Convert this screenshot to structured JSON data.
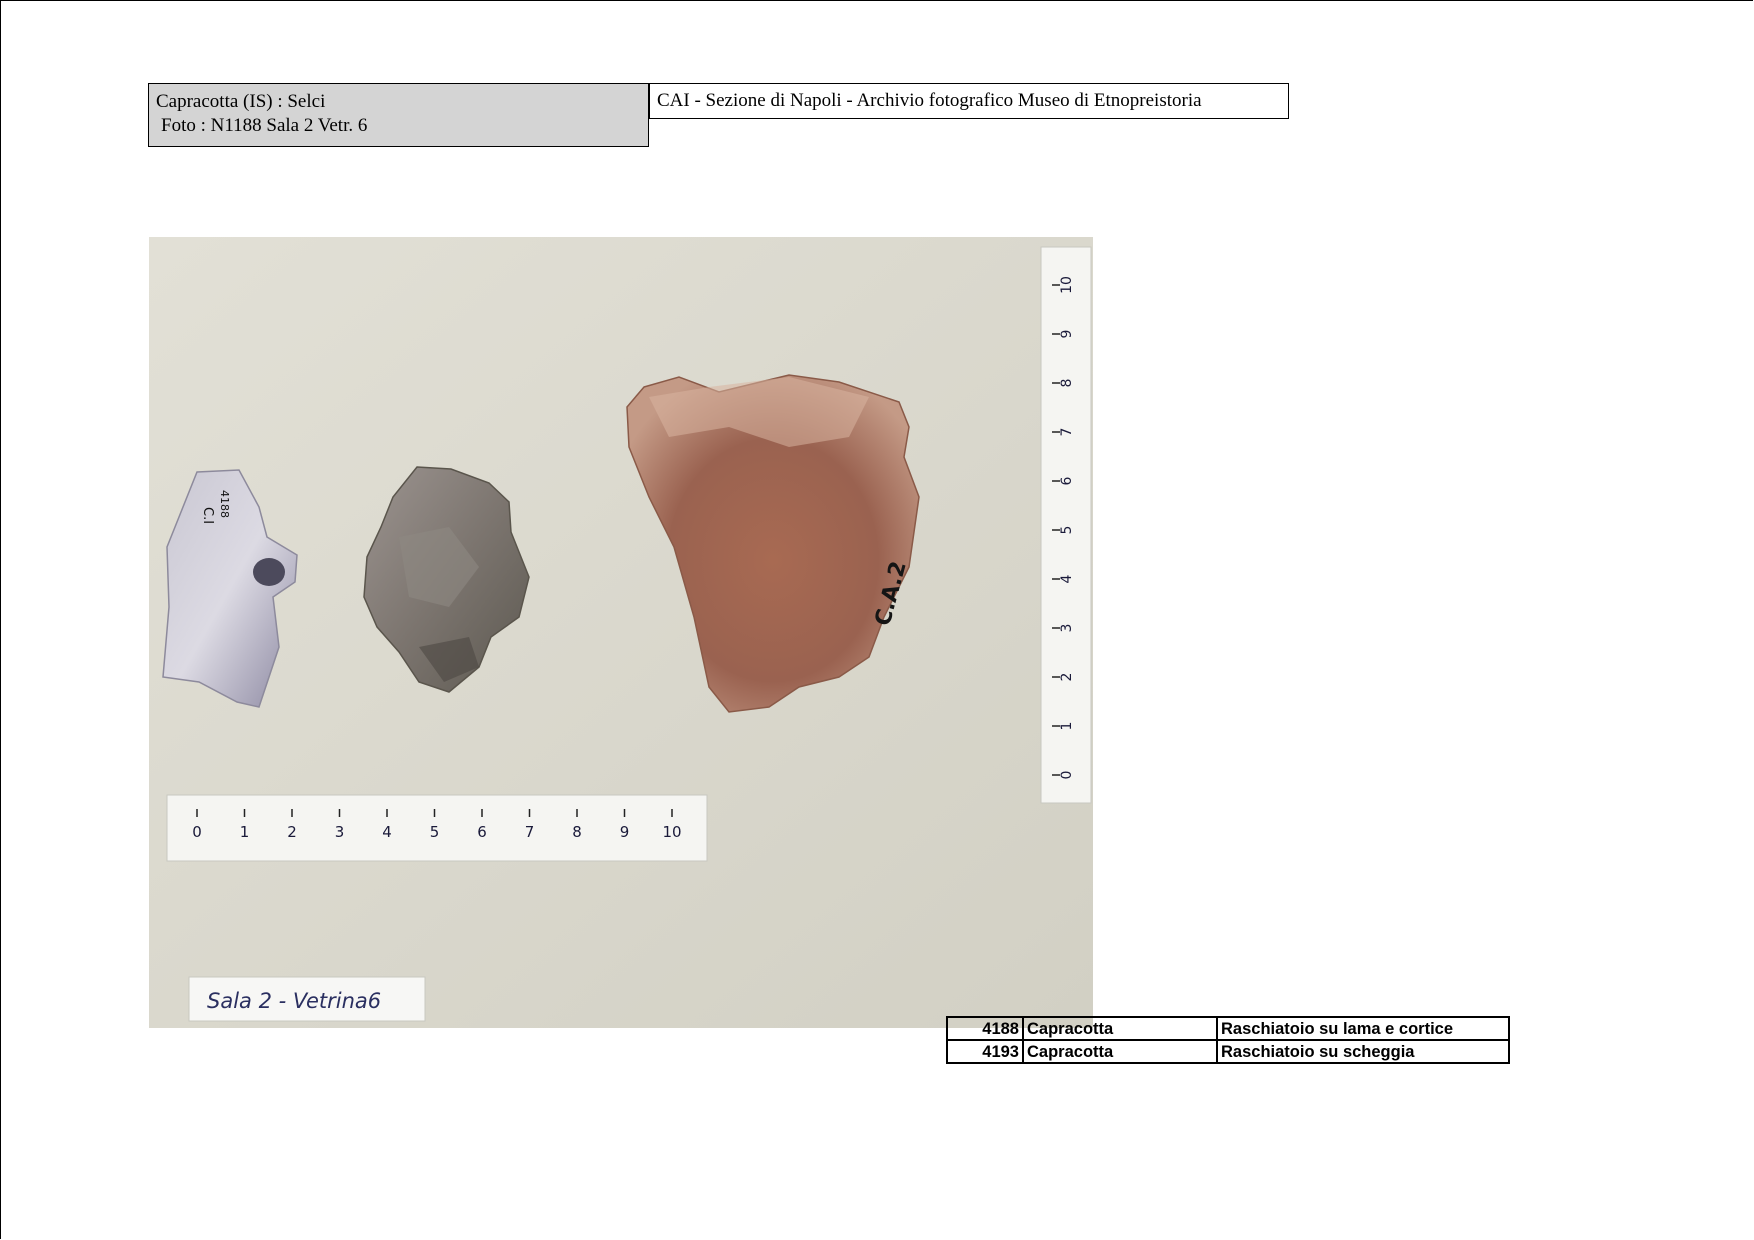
{
  "header": {
    "info_line1": "Capracotta   (IS)  :  Selci",
    "info_line2": "Foto : N1188  Sala 2 Vetr.  6",
    "archive_title": "CAI - Sezione di Napoli  - Archivio fotografico Museo di Etnopreistoria"
  },
  "photo": {
    "artifact_label_1a": "C.I",
    "artifact_label_1b": "4188",
    "artifact_label_2": "C.A.2",
    "case_label": "Sala 2 - Vetrina6",
    "ruler_ticks": [
      "0",
      "1",
      "2",
      "3",
      "4",
      "5",
      "6",
      "7",
      "8",
      "9",
      "10"
    ]
  },
  "catalog": {
    "rows": [
      {
        "number": "4188",
        "locality": "Capracotta",
        "description": "Raschiatoio su lama e cortice"
      },
      {
        "number": "4193",
        "locality": "Capracotta",
        "description": "Raschiatoio su scheggia"
      }
    ]
  }
}
